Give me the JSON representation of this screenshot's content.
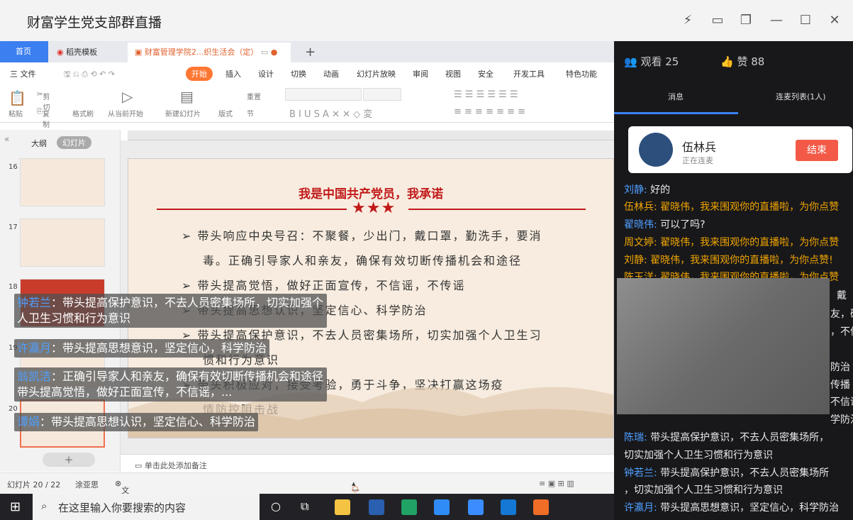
{
  "window": {
    "title": "财富学生党支部群直播"
  },
  "wps": {
    "tabs": [
      "首页",
      "稻壳模板",
      "财富管理学院2...织生活会（定）"
    ],
    "menu": [
      "三 文件",
      "开始",
      "插入",
      "设计",
      "切换",
      "动画",
      "幻灯片放映",
      "审阅",
      "视图",
      "安全",
      "开发工具",
      "特色功能"
    ],
    "toolbar": [
      "粘贴",
      "剪切",
      "复制",
      "格式刷",
      "从当前开始",
      "新建幻灯片",
      "版式",
      "重置",
      "节"
    ],
    "panel_tabs": [
      "大纲",
      "幻灯片"
    ],
    "slide_numbers": [
      "16",
      "17",
      "18",
      "19",
      "20"
    ],
    "notes_placeholder": "单击此处添加备注",
    "status": {
      "slide": "幻灯片 20 / 22",
      "author": "涂亚思",
      "protect": "文档未保护",
      "beautify": "一键美化"
    }
  },
  "slide": {
    "title": "我是中国共产党员，我承诺",
    "bullets": [
      "带头响应中央号召：不聚餐，少出门，戴口罩，勤洗手，要消",
      "毒。正确引导家人和亲友，确保有效切断传播机会和途径",
      "带头提高觉悟，做好正面宣传，不信谣，不传谣",
      "带头提高思想认识，坚定信心、科学防治",
      "带头提高保护意识，不去人员密集场所，切实加强个人卫生习",
      "惯和行为意识",
      "带头积极应对，接受考验，勇于斗争，坚决打赢这场疫",
      "情防控阻击战"
    ]
  },
  "danmu": [
    {
      "user": "钟若兰",
      "text": "：带头提高保护意识，不去人员密集场所，切实加强个人卫生习惯和行为意识"
    },
    {
      "user": "许瀛月",
      "text": "：带头提高思想意识，坚定信心，科学防治"
    },
    {
      "user": "翁凯洁",
      "text": "：正确引导家人和亲友，确保有效切断传播机会和途径带头提高觉悟，做好正面宣传，不信谣，..."
    },
    {
      "user": "谭娟",
      "text": "：带头提高思想认识，坚定信心、科学防治"
    }
  ],
  "taskbar": {
    "search_placeholder": "在这里输入你要搜索的内容"
  },
  "live": {
    "viewers": "观看 25",
    "likes": "赞 88",
    "tab_messages": "消息",
    "tab_mic": "连麦列表(1人)",
    "mic_user": {
      "name": "伍林兵",
      "status": "正在连麦",
      "end": "结束"
    },
    "messages": [
      {
        "user": "刘静:",
        "text": "好的",
        "orange": false
      },
      {
        "user": "伍林兵:",
        "text": "翟晓伟，我来围观你的直播啦，为你点赞",
        "orange": true
      },
      {
        "user": "翟晓伟:",
        "text": "可以了吗?",
        "orange": false
      },
      {
        "user": "周文婷:",
        "text": "翟晓伟，我来围观你的直播啦，为你点赞",
        "orange": true
      },
      {
        "user": "刘静:",
        "text": "翟晓伟，我来围观你的直播啦，为你点赞!",
        "orange": true
      },
      {
        "user": "陈玉洋:",
        "text": "翟晓伟，我来围观你的直播啦，为你点赞",
        "orange": true
      },
      {
        "user": "陈瑞:",
        "text": "带头提高保护意识，不去人员密集场所，",
        "orange": false
      },
      {
        "user": "",
        "text": "切实加强个人卫生习惯和行为意识",
        "orange": false
      },
      {
        "user": "钟若兰:",
        "text": "带头提高保护意识，不去人员密集场所",
        "orange": false
      },
      {
        "user": "",
        "text": "，切实加强个人卫生习惯和行为意识",
        "orange": false
      },
      {
        "user": "许瀛月:",
        "text": "带头提高思想意识，坚定信心，科学防治",
        "orange": false
      }
    ],
    "behind_video": [
      "戴",
      "友，确",
      "，不信",
      "防治",
      "传播",
      "不信谣",
      "学防治"
    ]
  }
}
